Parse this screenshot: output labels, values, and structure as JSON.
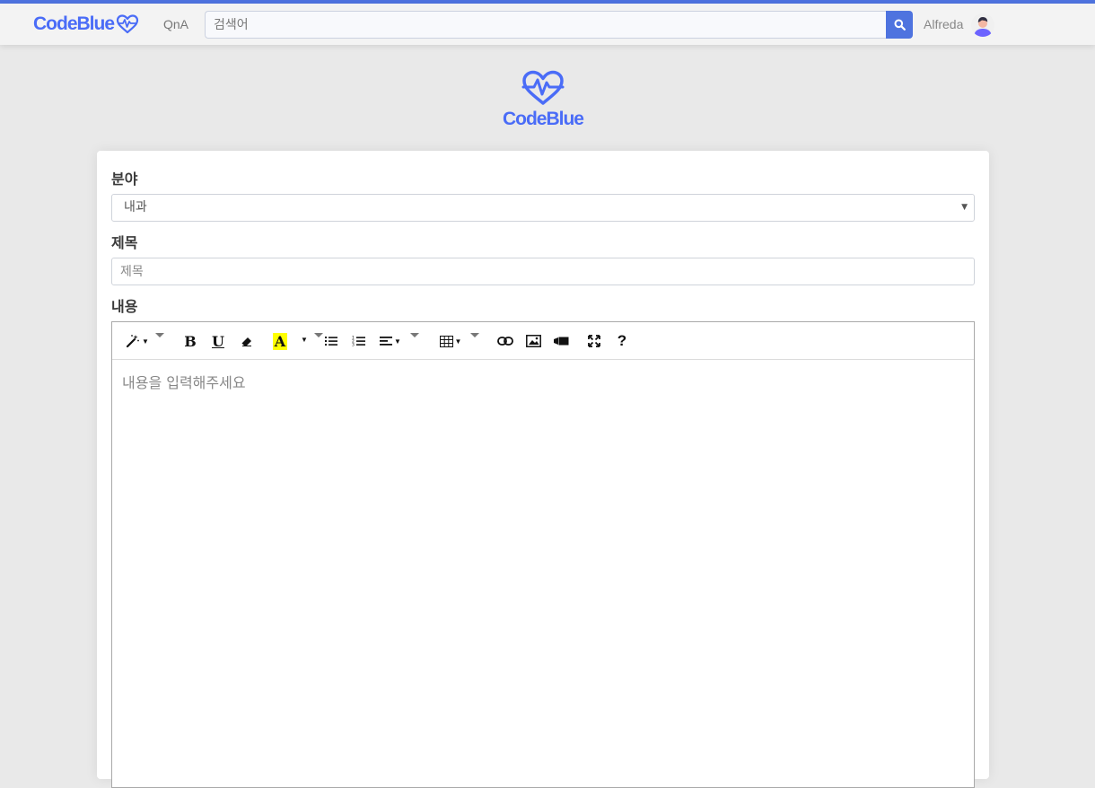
{
  "navbar": {
    "brand": "CodeBlue",
    "qna_link": "QnA",
    "search_placeholder": "검색어",
    "username": "Alfreda"
  },
  "hero": {
    "brand": "CodeBlue"
  },
  "form": {
    "category_label": "분야",
    "category_selected": "내과",
    "title_label": "제목",
    "title_placeholder": "제목",
    "content_label": "내용",
    "content_placeholder": "내용을 입력해주세요"
  },
  "toolbar": {
    "bold": "B",
    "underline": "U",
    "highlight": "A",
    "help": "?"
  },
  "colors": {
    "accent": "#4e73df",
    "brand": "#4a6cf7"
  }
}
